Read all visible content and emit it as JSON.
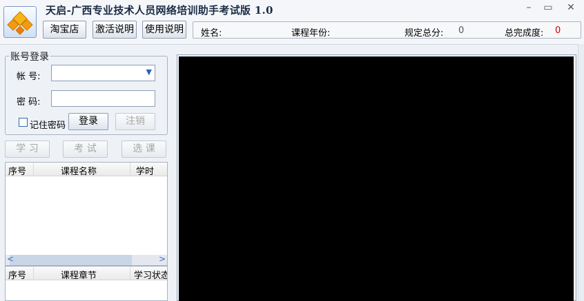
{
  "window": {
    "title": "天启-广西专业技术人员网络培训助手考试版 1.0"
  },
  "toolbar": {
    "taobao_label": "淘宝店",
    "activation_label": "激活说明",
    "usage_label": "使用说明"
  },
  "info_bar": {
    "name_label": "姓名:",
    "year_label": "课程年份:",
    "required_label": "规定总分:",
    "required_value": "0",
    "completion_label": "总完成度:",
    "completion_value": "0",
    "completion_color": "#d40000"
  },
  "login": {
    "legend": "账号登录",
    "account_label": "帐  号:",
    "account_value": "",
    "password_label": "密  码:",
    "password_value": "",
    "remember_label": "记住密码",
    "remember_checked": false,
    "login_label": "登录",
    "logout_label": "注销"
  },
  "actions": {
    "study_label": "学 习",
    "exam_label": "考 试",
    "select_label": "选 课"
  },
  "course_table": {
    "columns": [
      "序号",
      "课程名称",
      "学时"
    ],
    "rows": []
  },
  "chapter_table": {
    "columns": [
      "序号",
      "课程章节",
      "学习状态"
    ],
    "rows": []
  },
  "colors": {
    "accent": "#3166b3",
    "viewer_background": "#000000"
  }
}
